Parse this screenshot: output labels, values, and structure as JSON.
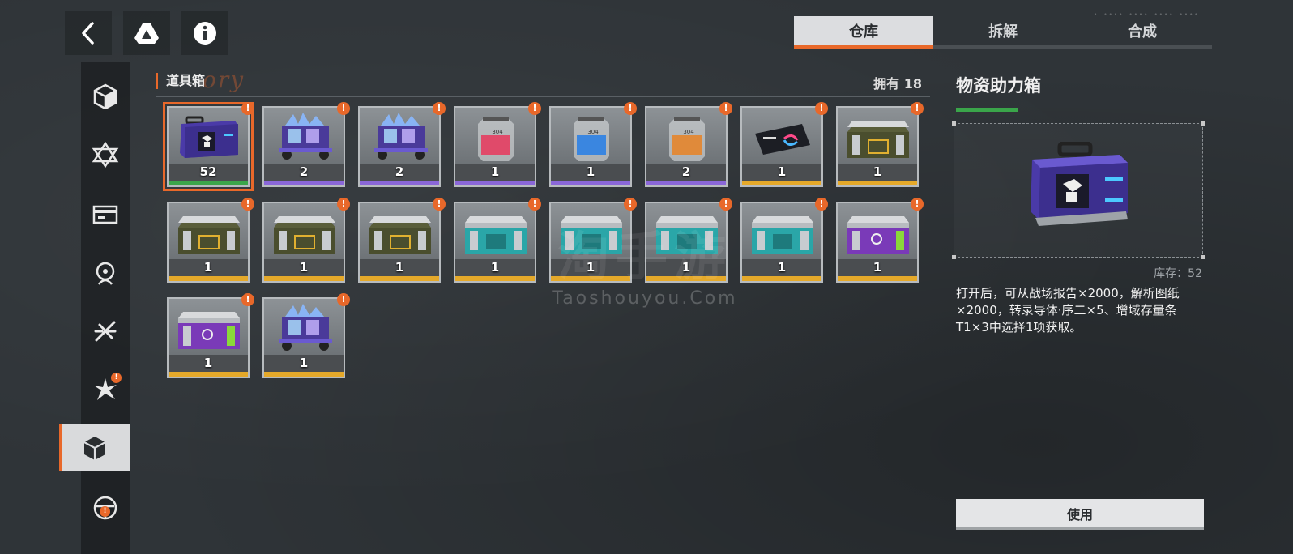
{
  "tabs": [
    {
      "label": "仓库",
      "active": true
    },
    {
      "label": "拆解",
      "active": false
    },
    {
      "label": "合成",
      "active": false
    }
  ],
  "top_icons": [
    "back-icon",
    "drive-triangle-icon",
    "info-icon"
  ],
  "rail": [
    {
      "icon": "cube-icon",
      "active": false,
      "badge": false
    },
    {
      "icon": "star-of-david-icon",
      "active": false,
      "badge": false
    },
    {
      "icon": "card-icon",
      "active": false,
      "badge": false
    },
    {
      "icon": "crosshair-figure-icon",
      "active": false,
      "badge": false
    },
    {
      "icon": "blade-icon",
      "active": false,
      "badge": false
    },
    {
      "icon": "burst-icon",
      "active": false,
      "badge": true
    },
    {
      "icon": "box-icon",
      "active": true,
      "badge": false
    },
    {
      "icon": "wheel-icon",
      "active": false,
      "badge": true
    }
  ],
  "list": {
    "title": "道具箱",
    "title_deco": "ory",
    "count_label": "拥有 18"
  },
  "rarity_colors": {
    "green": "#3aa54a",
    "purple": "#8a67d8",
    "gold": "#e5a92a"
  },
  "items": [
    {
      "qty": "52",
      "rarity": "green",
      "art": "purple-box",
      "selected": true
    },
    {
      "qty": "2",
      "rarity": "purple",
      "art": "crystal-cart"
    },
    {
      "qty": "2",
      "rarity": "purple",
      "art": "crystal-cart"
    },
    {
      "qty": "1",
      "rarity": "purple",
      "art": "red-capsule"
    },
    {
      "qty": "1",
      "rarity": "purple",
      "art": "blue-capsule"
    },
    {
      "qty": "2",
      "rarity": "purple",
      "art": "orange-capsule"
    },
    {
      "qty": "1",
      "rarity": "gold",
      "art": "card"
    },
    {
      "qty": "1",
      "rarity": "gold",
      "art": "olive-crate"
    },
    {
      "qty": "1",
      "rarity": "gold",
      "art": "olive-crate"
    },
    {
      "qty": "1",
      "rarity": "gold",
      "art": "olive-crate"
    },
    {
      "qty": "1",
      "rarity": "gold",
      "art": "olive-crate"
    },
    {
      "qty": "1",
      "rarity": "gold",
      "art": "teal-crate"
    },
    {
      "qty": "1",
      "rarity": "gold",
      "art": "teal-crate"
    },
    {
      "qty": "1",
      "rarity": "gold",
      "art": "teal-crate"
    },
    {
      "qty": "1",
      "rarity": "gold",
      "art": "teal-crate"
    },
    {
      "qty": "1",
      "rarity": "gold",
      "art": "violet-crate"
    },
    {
      "qty": "1",
      "rarity": "gold",
      "art": "violet-crate"
    },
    {
      "qty": "1",
      "rarity": "gold",
      "art": "crystal-cart"
    }
  ],
  "watermark": {
    "cn": "淘手游",
    "en": "Taoshouyou.Com"
  },
  "detail": {
    "title": "物资助力箱",
    "stock": "库存：52",
    "description": "打开后，可从战场报告×2000，解析图纸×2000，转录导体·序二×5、增域存量条T1×3中选择1项获取。",
    "use_label": "使用"
  }
}
